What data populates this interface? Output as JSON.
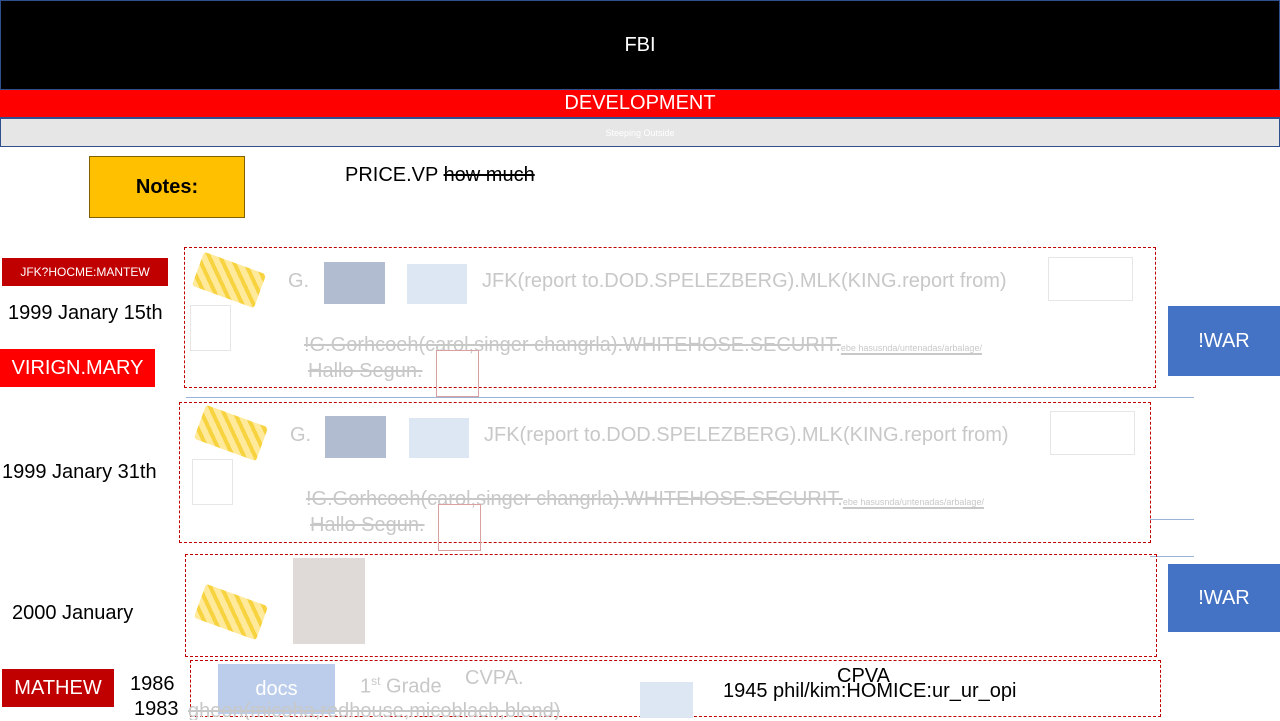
{
  "header": {
    "title": "FBI"
  },
  "subbar": {
    "label": "DEVELOPMENT"
  },
  "greybar": {
    "label": "Steeping Outside"
  },
  "notes": {
    "label": "Notes:"
  },
  "price": {
    "main": "PRICE.VP",
    "struck": "how much"
  },
  "left": {
    "tag_jfk": "JFK?HOCME:MANTEW",
    "date1": "1999 Janary 15th",
    "tag_virign": "VIRIGN.MARY",
    "date2": "1999 Janary 31th",
    "date3": "2000 January",
    "tag_mathew": "MATHEW",
    "year1": "1986",
    "year2": "1983"
  },
  "panel": {
    "g_label": "G.",
    "line1": "JFK(report to.DOD.SPELEZBERG).MLK(KING.report from)",
    "line2": "!G.Gorhcoeh(carol,singer changrla).WHITEHOSE.SECURIT.",
    "line2_small": "ebe hasusnda/untenadas/arbalage/",
    "line3": "Hallo Segun."
  },
  "war": {
    "label": "!WAR"
  },
  "bottom": {
    "docs": "docs",
    "grade": "1",
    "grade_sup": "st",
    "grade_suffix": " Grade",
    "cvpa": "CVPA.",
    "cpva": "CPVA",
    "homice": "1945 phil/kim:HOMICE:ur_ur_opi",
    "cut_text": "gheon(micoha,redhouse,micoblach,blend)"
  },
  "colors": {
    "header_bg": "#000000",
    "accent_red": "#ff0000",
    "dark_red": "#c00000",
    "notes_yellow": "#ffc000",
    "war_blue": "#4472c4"
  }
}
